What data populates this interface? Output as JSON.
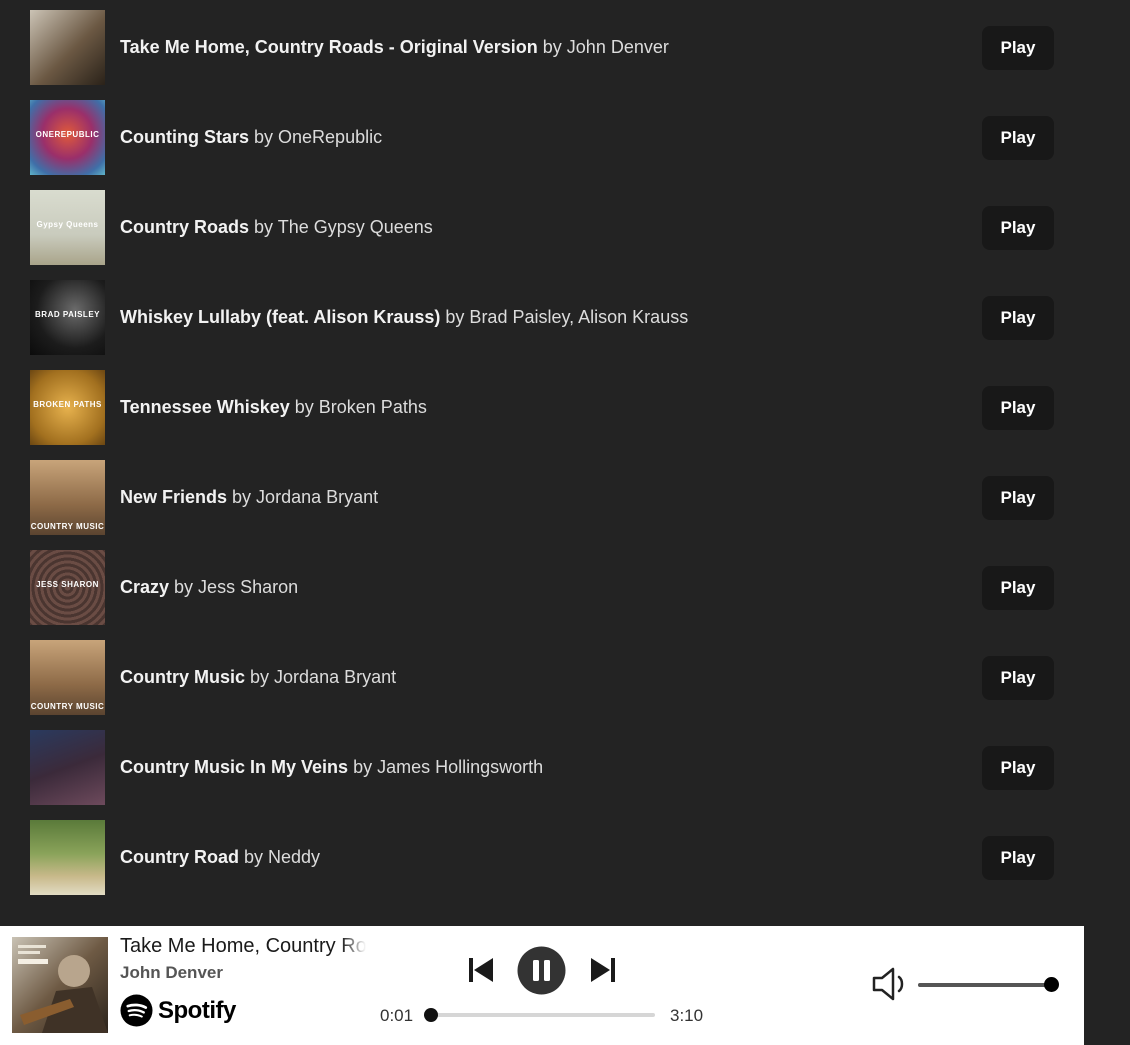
{
  "tracks": [
    {
      "title": "Take Me Home, Country Roads - Original Version",
      "by": "by John Denver",
      "cover": "john-denver-cover",
      "play_label": "Play"
    },
    {
      "title": "Counting Stars",
      "by": "by OneRepublic",
      "cover": "onerepublic-cover",
      "cover_text": "ONEREPUBLIC",
      "play_label": "Play"
    },
    {
      "title": "Country Roads",
      "by": "by The Gypsy Queens",
      "cover": "gypsy-queens-cover",
      "cover_text": "Gypsy Queens",
      "play_label": "Play"
    },
    {
      "title": "Whiskey Lullaby (feat. Alison Krauss)",
      "by": "by Brad Paisley, Alison Krauss",
      "cover": "brad-paisley-cover",
      "cover_text": "BRAD PAISLEY",
      "play_label": "Play"
    },
    {
      "title": "Tennessee Whiskey",
      "by": "by Broken Paths",
      "cover": "broken-paths-cover",
      "cover_text": "BROKEN PATHS",
      "play_label": "Play"
    },
    {
      "title": "New Friends",
      "by": "by Jordana Bryant",
      "cover": "jordana-bryant-cover",
      "cover_text": "COUNTRY MUSIC",
      "play_label": "Play"
    },
    {
      "title": "Crazy",
      "by": "by Jess Sharon",
      "cover": "jess-sharon-cover",
      "cover_text": "JESS SHARON",
      "play_label": "Play"
    },
    {
      "title": "Country Music",
      "by": "by Jordana Bryant",
      "cover": "jordana-bryant-cover",
      "cover_text": "COUNTRY MUSIC",
      "play_label": "Play"
    },
    {
      "title": "Country Music In My Veins",
      "by": "by James Hollingsworth",
      "cover": "james-hollingsworth-cover",
      "play_label": "Play"
    },
    {
      "title": "Country Road",
      "by": "by Neddy",
      "cover": "neddy-cover",
      "play_label": "Play"
    }
  ],
  "player": {
    "title": "Take Me Home, Country Roads - Original Version",
    "artist": "John Denver",
    "brand": "Spotify",
    "elapsed": "0:01",
    "duration": "3:10",
    "progress_fraction": 0.0,
    "volume_fraction": 1.0,
    "icons": {
      "previous": "skip-previous-icon",
      "pause": "pause-icon",
      "next": "skip-next-icon",
      "volume": "volume-icon",
      "brand": "spotify-icon"
    }
  },
  "colors": {
    "background": "#232323",
    "button": "#181818",
    "player_bg": "#ffffff"
  }
}
